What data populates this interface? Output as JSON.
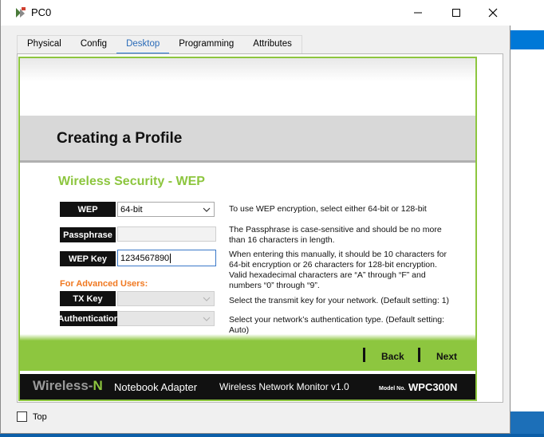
{
  "window": {
    "title": "PC0"
  },
  "tabs": [
    {
      "label": "Physical"
    },
    {
      "label": "Config"
    },
    {
      "label": "Desktop"
    },
    {
      "label": "Programming"
    },
    {
      "label": "Attributes"
    }
  ],
  "active_tab": "Desktop",
  "page": {
    "heading": "Creating a Profile",
    "section_title": "Wireless Security - WEP",
    "advanced_label": "For Advanced Users:"
  },
  "fields": {
    "wep": {
      "label": "WEP",
      "value": "64-bit",
      "description": "To use WEP encryption, select either 64-bit or 128-bit"
    },
    "passphrase": {
      "label": "Passphrase",
      "value": "",
      "description_1": "The Passphrase is case-sensitive and should be no more",
      "description_2": "than 16 characters in length."
    },
    "wep_key": {
      "label": "WEP Key",
      "value": "1234567890",
      "description_1": "When entering this manually, it should be 10 characters for",
      "description_2": "64-bit encryption or 26 characters for 128-bit encryption.",
      "description_3": "Valid hexadecimal characters are “A”  through “F” and",
      "description_4": "numbers “0”  through “9”."
    },
    "tx_key": {
      "label": "TX Key",
      "value": "",
      "description": "Select the transmit key for your network. (Default setting: 1)"
    },
    "authentication": {
      "label": "Authentication",
      "value": "",
      "description": "Select your network’s authentication type. (Default setting: Auto)"
    }
  },
  "nav": {
    "back": "Back",
    "next": "Next"
  },
  "footer": {
    "brand_main": "Wireless-",
    "brand_n": "N",
    "brand_sub": "Notebook Adapter",
    "monitor": "Wireless Network Monitor  v1.0",
    "model_label": "Model No.",
    "model": "WPC300N"
  },
  "bottom": {
    "top_checkbox_label": "Top"
  },
  "colors": {
    "accent_green": "#8dc63f",
    "advanced_orange": "#f07820",
    "active_tab_blue": "#2a7ad6"
  }
}
